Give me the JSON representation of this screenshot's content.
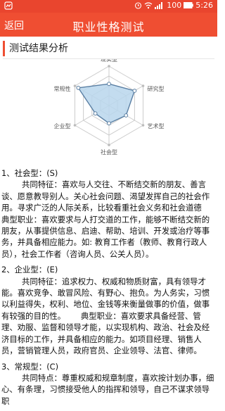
{
  "status_bar": {
    "battery": "100",
    "time": "5:26",
    "icons": [
      "notification-icon",
      "alarm-icon",
      "wifi-icon",
      "signal-icon",
      "battery-icon"
    ]
  },
  "app_bar": {
    "back_label": "返回",
    "title": "职业性格测试"
  },
  "section": {
    "title": "测试结果分析"
  },
  "chart_data": {
    "type": "radar",
    "axes": [
      "现实型",
      "研究型",
      "艺术型",
      "社会型",
      "企业型",
      "常规性"
    ],
    "series": [
      {
        "values": [
          0.55,
          0.75,
          0.5,
          0.45,
          0.4,
          0.9
        ]
      }
    ],
    "rmax": 1,
    "rings": 4,
    "colors": {
      "fill": "#b9d6ec",
      "line": "#5a7fa3",
      "grid": "#cccccc"
    }
  },
  "content": {
    "sections": [
      {
        "heading": "1、社会型：(S)",
        "lines": [
          "        共同特征：喜欢与人交往、不断结交新的朋友、善言谈、愿意教导别人。关心社会问题、渴望发挥自己的社会作用。寻求广泛的人际关系，比较看重社会义务和社会道德        典型职业：喜欢要求与人打交道的工作，能够不断结交新的朋友，从事提供信息、启迪、帮助、培训、开发或治疗等事务，并具备相应能力。如: 教育工作者（教师、教育行政人员），社会工作者（咨询人员、公关人员）。"
        ]
      },
      {
        "heading": "2、企业型：(E)",
        "lines": [
          "        共同特征：追求权力、权威和物质财富，具有领导才能。喜欢竞争、敢冒风险、有野心、抱负。为人务实，习惯以利益得失，权利、地位、金钱等来衡量做事的价值，做事有较强的目的性。      典型职业：喜欢要求具备经营、管理、劝服、监督和领导才能，以实现机构、政治、社会及经济目标的工作，并具备相应的能力。如项目经理、销售人员，营销管理人员，政府官员、企业领导、法官、律师。"
        ]
      },
      {
        "heading": "3、常规型：(C)",
        "lines": [
          "        共同特点：尊重权威和规章制度，喜欢按计划办事，细心、有条理，习惯接受他人的指挥和领导，自己不谋求领导职"
        ]
      }
    ]
  }
}
